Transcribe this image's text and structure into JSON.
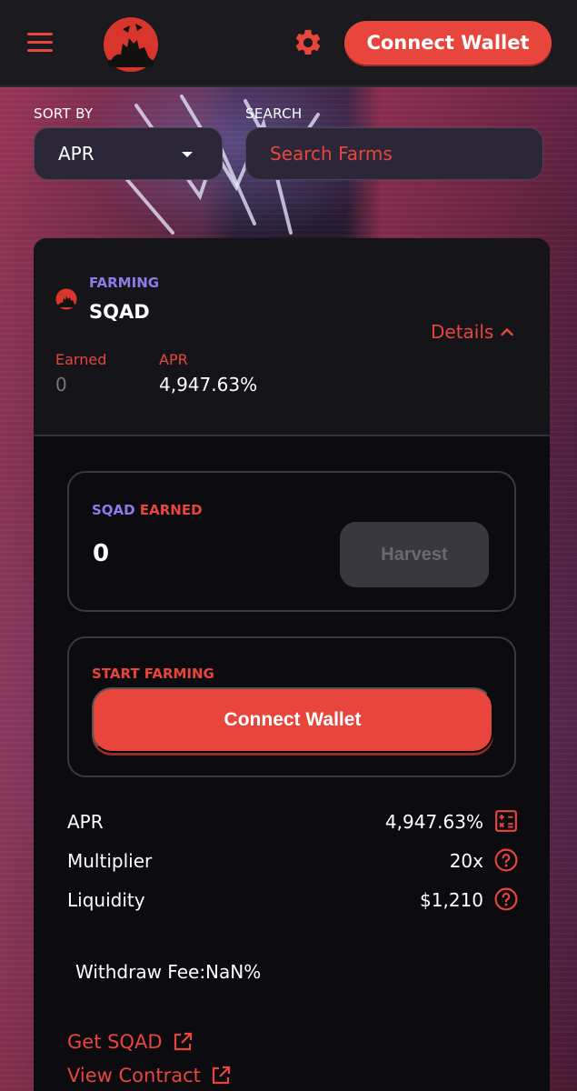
{
  "header": {
    "connect_label": "Connect Wallet",
    "accent": "#e8453c"
  },
  "controls": {
    "sort_label": "SORT BY",
    "sort_value": "APR",
    "search_label": "SEARCH",
    "search_placeholder": "Search Farms"
  },
  "farm": {
    "status": "FARMING",
    "name": "SQAD",
    "details_label": "Details",
    "earned_label": "Earned",
    "earned_value": "0",
    "apr_label": "APR",
    "apr_value": "4,947.63%"
  },
  "earned_panel": {
    "token": "SQAD",
    "label": "EARNED",
    "amount": "0",
    "harvest_label": "Harvest"
  },
  "farm_panel": {
    "label": "START FARMING",
    "connect_label": "Connect Wallet"
  },
  "info": [
    {
      "label": "APR",
      "value": "4,947.63%",
      "icon": "calculator-icon"
    },
    {
      "label": "Multiplier",
      "value": "20x",
      "icon": "help-icon"
    },
    {
      "label": "Liquidity",
      "value": "$1,210",
      "icon": "help-icon"
    }
  ],
  "withdraw_fee": "Withdraw Fee:NaN%",
  "links": {
    "get_token": "Get SQAD",
    "view_contract": "View Contract"
  }
}
